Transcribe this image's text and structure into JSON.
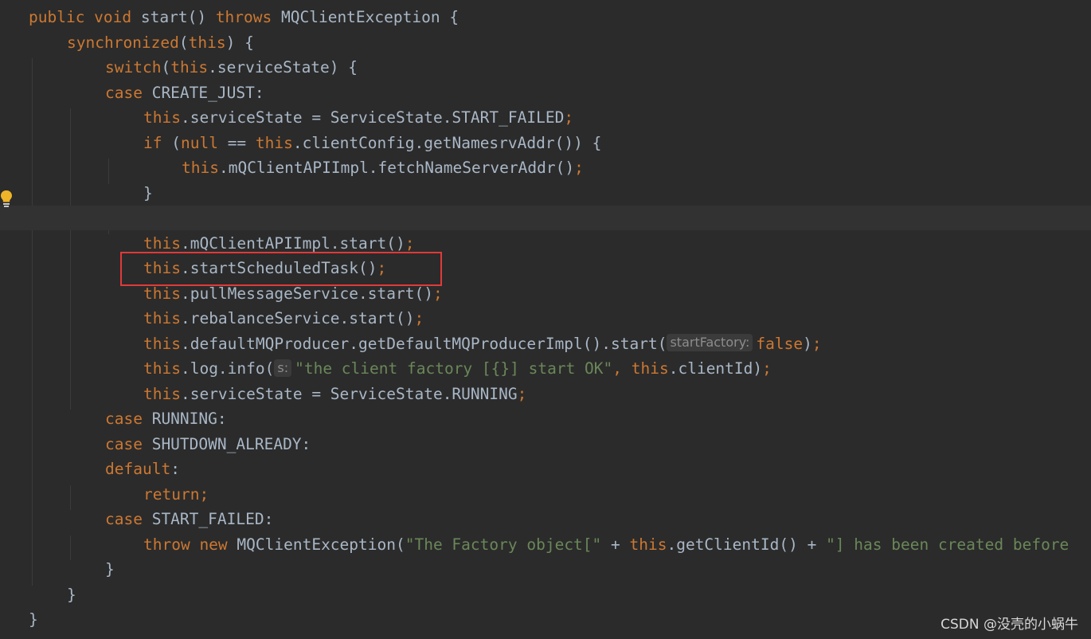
{
  "editor": {
    "lines": [
      [
        [
          "kw",
          "public void "
        ],
        [
          "pl",
          "start() "
        ],
        [
          "kw",
          "throws "
        ],
        [
          "pl",
          "MQClientException {"
        ]
      ],
      [
        [
          "kw",
          "synchronized"
        ],
        [
          "pl",
          "("
        ],
        [
          "kw",
          "this"
        ],
        [
          "pl",
          ") {"
        ]
      ],
      [
        [
          "kw",
          "switch"
        ],
        [
          "pl",
          "("
        ],
        [
          "kw",
          "this"
        ],
        [
          "pl",
          ".serviceState) {"
        ]
      ],
      [
        [
          "kw",
          "case "
        ],
        [
          "pl",
          "CREATE_JUST:"
        ]
      ],
      [
        [
          "kw",
          "this"
        ],
        [
          "pl",
          ".serviceState = ServiceState.START_FAILED"
        ],
        [
          "kw",
          ";"
        ]
      ],
      [
        [
          "kw",
          "if "
        ],
        [
          "pl",
          "("
        ],
        [
          "kw",
          "null "
        ],
        [
          "pl",
          "== "
        ],
        [
          "kw",
          "this"
        ],
        [
          "pl",
          ".clientConfig.getNamesrvAddr()) {"
        ]
      ],
      [
        [
          "kw",
          "this"
        ],
        [
          "pl",
          ".mQClientAPIImpl.fetchNameServerAddr()"
        ],
        [
          "kw",
          ";"
        ]
      ],
      [
        [
          "pl",
          "}"
        ]
      ],
      [],
      [
        [
          "kw",
          "this"
        ],
        [
          "pl",
          ".mQClientAPIImpl.start()"
        ],
        [
          "kw",
          ";"
        ]
      ],
      [
        [
          "kw",
          "this"
        ],
        [
          "pl",
          ".startScheduledTask()"
        ],
        [
          "kw",
          ";"
        ]
      ],
      [
        [
          "kw",
          "this"
        ],
        [
          "pl",
          ".pullMessageService.start()"
        ],
        [
          "kw",
          ";"
        ]
      ],
      [
        [
          "kw",
          "this"
        ],
        [
          "pl",
          ".rebalanceService.start()"
        ],
        [
          "kw",
          ";"
        ]
      ],
      [
        [
          "kw",
          "this"
        ],
        [
          "pl",
          ".defaultMQProducer.getDefaultMQProducerImpl().start("
        ],
        [
          "hint",
          "startFactory:"
        ],
        [
          "kw",
          "false"
        ],
        [
          "pl",
          ")"
        ],
        [
          "kw",
          ";"
        ]
      ],
      [
        [
          "kw",
          "this"
        ],
        [
          "pl",
          ".log.info("
        ],
        [
          "hint",
          "s:"
        ],
        [
          "str",
          "\"the client factory [{}] start OK\""
        ],
        [
          "kw",
          ", this"
        ],
        [
          "pl",
          ".clientId)"
        ],
        [
          "kw",
          ";"
        ]
      ],
      [
        [
          "kw",
          "this"
        ],
        [
          "pl",
          ".serviceState = ServiceState.RUNNING"
        ],
        [
          "kw",
          ";"
        ]
      ],
      [
        [
          "kw",
          "case "
        ],
        [
          "pl",
          "RUNNING:"
        ]
      ],
      [
        [
          "kw",
          "case "
        ],
        [
          "pl",
          "SHUTDOWN_ALREADY:"
        ]
      ],
      [
        [
          "kw",
          "default"
        ],
        [
          "pl",
          ":"
        ]
      ],
      [
        [
          "kw",
          "return;"
        ]
      ],
      [
        [
          "kw",
          "case "
        ],
        [
          "pl",
          "START_FAILED:"
        ]
      ],
      [
        [
          "kw",
          "throw new "
        ],
        [
          "pl",
          "MQClientException("
        ],
        [
          "str",
          "\"The Factory object[\" "
        ],
        [
          "pl",
          "+ "
        ],
        [
          "kw",
          "this"
        ],
        [
          "pl",
          ".getClientId() + "
        ],
        [
          "str",
          "\"] has been created before"
        ]
      ],
      [
        [
          "pl",
          "}"
        ]
      ],
      [
        [
          "pl",
          "}"
        ]
      ],
      [
        [
          "pl",
          "}"
        ]
      ]
    ],
    "indent_levels": [
      0,
      1,
      2,
      2,
      3,
      3,
      4,
      3,
      3,
      3,
      3,
      3,
      3,
      3,
      3,
      3,
      2,
      2,
      2,
      3,
      2,
      3,
      2,
      1,
      0
    ],
    "current_line": 8,
    "highlighted_line": 10,
    "colors": {
      "keyword": "#cc7832",
      "plain": "#a9b7c6",
      "string": "#6a8759",
      "background": "#2b2b2b",
      "highlight_box": "#e03a3a"
    },
    "gutter_icon": "lightbulb-icon"
  },
  "watermark": {
    "text": "CSDN @没壳的小蜗牛"
  }
}
